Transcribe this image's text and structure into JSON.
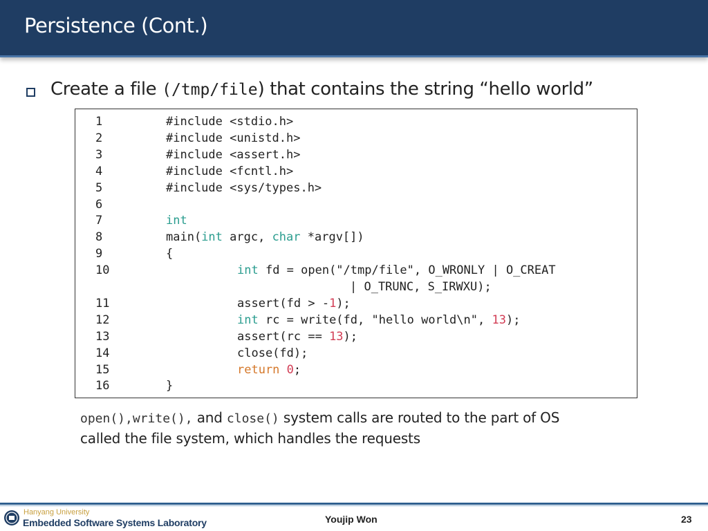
{
  "slide": {
    "title": "Persistence (Cont.)",
    "heading": {
      "part1": "Create a file ",
      "path": "(/tmp/file",
      "part2": ") that contains the string “hello world”"
    },
    "code_lines": [
      {
        "n": "1",
        "tokens": [
          {
            "t": "#include <stdio.h>",
            "c": "plain"
          }
        ]
      },
      {
        "n": "2",
        "tokens": [
          {
            "t": "#include <unistd.h>",
            "c": "plain"
          }
        ]
      },
      {
        "n": "3",
        "tokens": [
          {
            "t": "#include <assert.h>",
            "c": "plain"
          }
        ]
      },
      {
        "n": "4",
        "tokens": [
          {
            "t": "#include <fcntl.h>",
            "c": "plain"
          }
        ]
      },
      {
        "n": "5",
        "tokens": [
          {
            "t": "#include <sys/types.h>",
            "c": "plain"
          }
        ]
      },
      {
        "n": "6",
        "tokens": []
      },
      {
        "n": "7",
        "tokens": [
          {
            "t": "int",
            "c": "kw"
          }
        ]
      },
      {
        "n": "8",
        "tokens": [
          {
            "t": "main(",
            "c": "plain"
          },
          {
            "t": "int",
            "c": "kw"
          },
          {
            "t": " argc, ",
            "c": "plain"
          },
          {
            "t": "char",
            "c": "kw"
          },
          {
            "t": " *argv[])",
            "c": "plain"
          }
        ]
      },
      {
        "n": "9",
        "tokens": [
          {
            "t": "{",
            "c": "plain"
          }
        ]
      },
      {
        "n": "10",
        "indent": 2,
        "tokens": [
          {
            "t": "int",
            "c": "kw"
          },
          {
            "t": " fd = open(\"/tmp/file\", O_WRONLY | O_CREAT",
            "c": "plain"
          }
        ]
      },
      {
        "n": "",
        "indent": 3,
        "tokens": [
          {
            "t": "| O_TRUNC, S_IRWXU);",
            "c": "plain"
          }
        ]
      },
      {
        "n": "11",
        "indent": 2,
        "tokens": [
          {
            "t": "assert(fd > -",
            "c": "plain"
          },
          {
            "t": "1",
            "c": "num"
          },
          {
            "t": ");",
            "c": "plain"
          }
        ]
      },
      {
        "n": "12",
        "indent": 2,
        "tokens": [
          {
            "t": "int",
            "c": "kw"
          },
          {
            "t": " rc = write(fd, \"hello world\\n\", ",
            "c": "plain"
          },
          {
            "t": "13",
            "c": "num"
          },
          {
            "t": ");",
            "c": "plain"
          }
        ]
      },
      {
        "n": "13",
        "indent": 2,
        "tokens": [
          {
            "t": "assert(rc == ",
            "c": "plain"
          },
          {
            "t": "13",
            "c": "num"
          },
          {
            "t": ");",
            "c": "plain"
          }
        ]
      },
      {
        "n": "14",
        "indent": 2,
        "tokens": [
          {
            "t": "close(fd);",
            "c": "plain"
          }
        ]
      },
      {
        "n": "15",
        "indent": 2,
        "tokens": [
          {
            "t": "return",
            "c": "ret"
          },
          {
            "t": " ",
            "c": "plain"
          },
          {
            "t": "0",
            "c": "num"
          },
          {
            "t": ";",
            "c": "plain"
          }
        ]
      },
      {
        "n": "16",
        "tokens": [
          {
            "t": "}",
            "c": "plain"
          }
        ]
      }
    ],
    "caption": {
      "code1": "open(),",
      "code2": "write(),",
      "and": " and ",
      "code3": "close()",
      "rest_line1": " system calls are routed to the part of OS",
      "rest_line2": "called the file system, which handles the requests"
    }
  },
  "footer": {
    "university": "Hanyang University",
    "lab": "Embedded Software Systems Laboratory",
    "author": "Youjip Won",
    "page": "23"
  },
  "colors": {
    "title_bg": "#1f3d63",
    "keyword": "#2b9d8f",
    "return_keyword": "#d5782a",
    "number": "#d23d55"
  }
}
